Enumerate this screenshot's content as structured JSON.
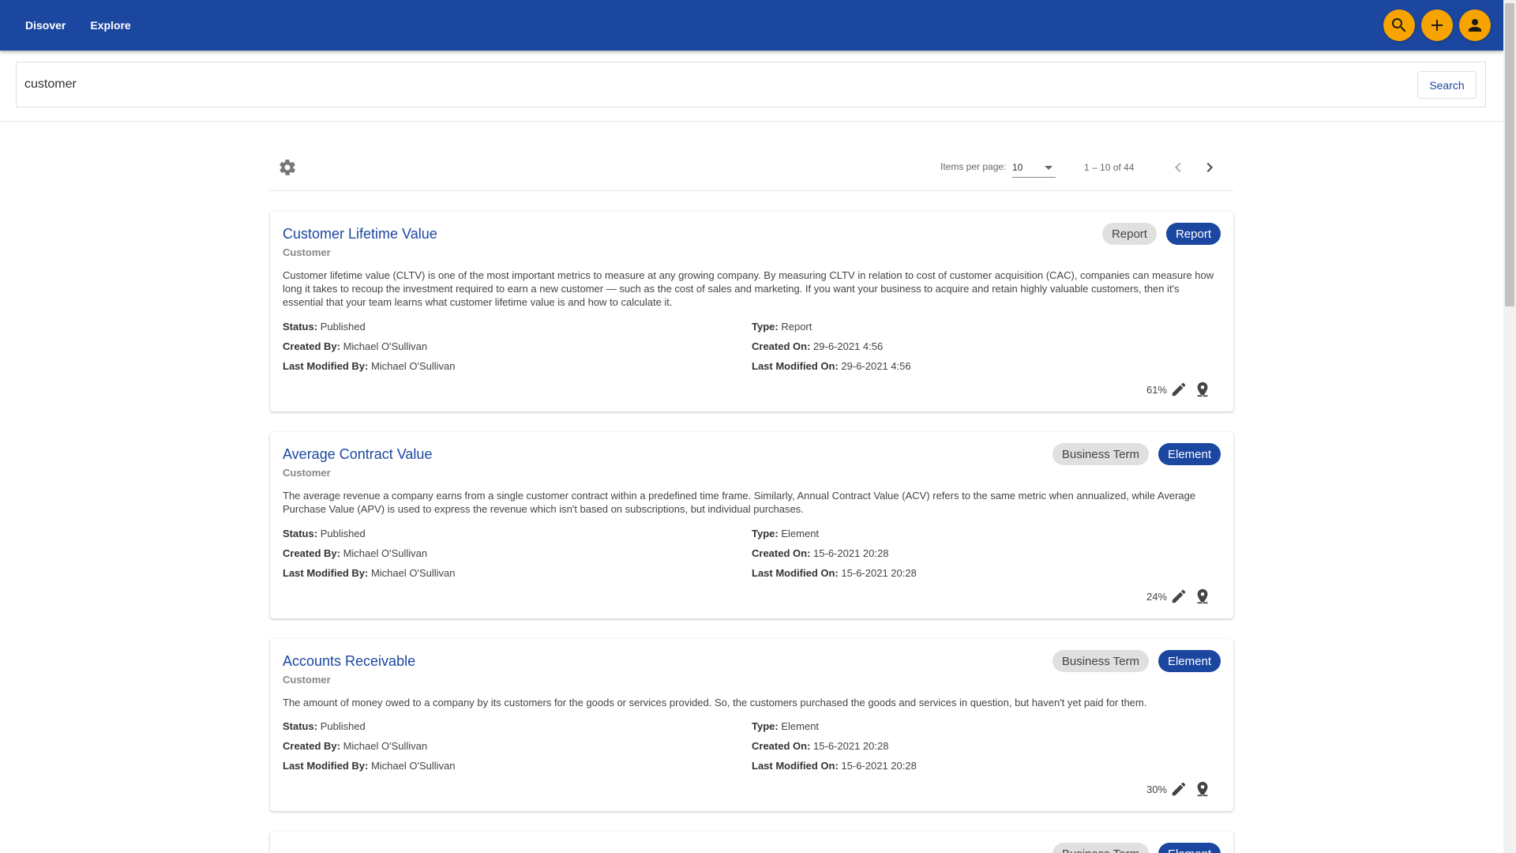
{
  "nav": {
    "discover": "Disover",
    "explore": "Explore"
  },
  "top_actions": [
    "search-icon",
    "add-icon",
    "account-icon"
  ],
  "colors": {
    "primary": "#1c47a0",
    "accent": "#f7a400"
  },
  "search": {
    "value": "customer",
    "button": "Search"
  },
  "paginator": {
    "items_per_page_label": "Items per page:",
    "items_per_page": "10",
    "range": "1 – 10 of 44"
  },
  "labels": {
    "status": "Status:",
    "type": "Type:",
    "created_by": "Created By:",
    "created_on": "Created On:",
    "last_modified_by": "Last Modified By:",
    "last_modified_on": "Last Modified On:"
  },
  "results": [
    {
      "title": "Customer Lifetime Value",
      "subtitle": "Customer",
      "chip_category": "Report",
      "chip_type": "Report",
      "description": "Customer lifetime value (CLTV) is one of the most important metrics to measure at any growing company. By measuring CLTV in relation to cost of customer acquisition (CAC), companies can measure how long it takes to recoup the investment required to earn a new customer — such as the cost of sales and marketing. If you want your business to acquire and retain highly valuable customers, then it's essential that your team learns what customer lifetime value is and how to calculate it.",
      "status": "Published",
      "type": "Report",
      "created_by": "Michael O'Sullivan",
      "created_on": "29-6-2021 4:56",
      "last_modified_by": "Michael O'Sullivan",
      "last_modified_on": "29-6-2021 4:56",
      "score": "61%"
    },
    {
      "title": "Average Contract Value",
      "subtitle": "Customer",
      "chip_category": "Business Term",
      "chip_type": "Element",
      "description": "The average revenue a company earns from a single customer contract within a predefined time frame. Similarly, Annual Contract Value (ACV) refers to the same metric when annualized, while Average Purchase Value (APV) is used to express the revenue which isn't based on subscriptions, but individual purchases.",
      "status": "Published",
      "type": "Element",
      "created_by": "Michael O'Sullivan",
      "created_on": "15-6-2021 20:28",
      "last_modified_by": "Michael O'Sullivan",
      "last_modified_on": "15-6-2021 20:28",
      "score": "24%"
    },
    {
      "title": "Accounts Receivable",
      "subtitle": "Customer",
      "chip_category": "Business Term",
      "chip_type": "Element",
      "description": "The amount of money owed to a company by its customers for the goods or services provided. So, the customers purchased the goods and services in question, but haven't yet paid for them.",
      "status": "Published",
      "type": "Element",
      "created_by": "Michael O'Sullivan",
      "created_on": "15-6-2021 20:28",
      "last_modified_by": "Michael O'Sullivan",
      "last_modified_on": "15-6-2021 20:28",
      "score": "30%"
    },
    {
      "chip_category": "Business Term",
      "chip_type": "Element"
    }
  ]
}
